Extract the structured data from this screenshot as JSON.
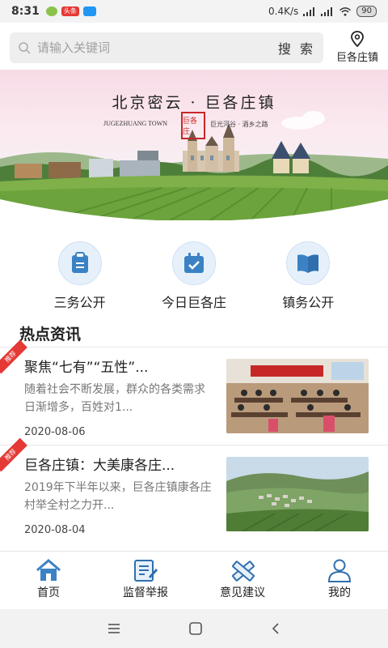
{
  "status_bar": {
    "time": "8:31",
    "toutiao_badge": "头条",
    "network_speed": "0.4K/s",
    "battery": "90"
  },
  "search": {
    "placeholder": "请输入关键词",
    "button_label": "搜 索",
    "location_label": "巨各庄镇"
  },
  "banner": {
    "title": "北京密云 · 巨各庄镇",
    "subtitle_en": "JUGEZHUANG TOWN",
    "slogan": "巨光河谷 · 酒乡之路",
    "seal_text": "巨各庄"
  },
  "quick_nav": [
    {
      "label": "三务公开",
      "icon": "clipboard-icon"
    },
    {
      "label": "今日巨各庄",
      "icon": "calendar-check-icon"
    },
    {
      "label": "镇务公开",
      "icon": "book-icon"
    }
  ],
  "section": {
    "title": "热点资讯"
  },
  "news": [
    {
      "tag": "推荐",
      "title": "聚焦“七有”“五性”...",
      "summary": "随着社会不断发展，群众的各类需求日渐增多，百姓对1...",
      "date": "2020-08-06",
      "thumb": "meeting-photo"
    },
    {
      "tag": "推荐",
      "title": "巨各庄镇：大美康各庄...",
      "summary": "2019年下半年以来，巨各庄镇康各庄村举全村之力开...",
      "date": "2020-08-04",
      "thumb": "village-aerial-photo"
    }
  ],
  "tabs": [
    {
      "label": "首页",
      "icon": "home-icon",
      "active": true
    },
    {
      "label": "监督举报",
      "icon": "report-icon",
      "active": false
    },
    {
      "label": "意见建议",
      "icon": "pencil-ruler-icon",
      "active": false
    },
    {
      "label": "我的",
      "icon": "user-icon",
      "active": false
    }
  ],
  "colors": {
    "accent": "#3b82c4",
    "tag_red": "#e53935",
    "text": "#222222",
    "muted": "#777777"
  }
}
